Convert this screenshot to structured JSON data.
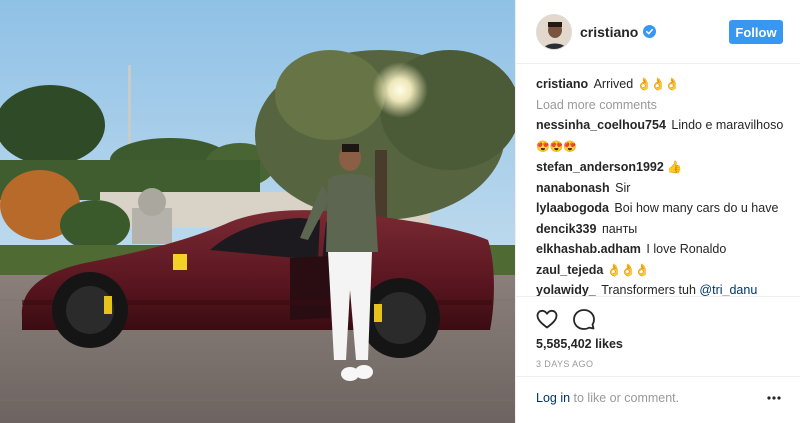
{
  "post": {
    "username": "cristiano",
    "follow_label": "Follow",
    "caption_user": "cristiano",
    "caption_text": "Arrived",
    "caption_emojis": "👌👌👌",
    "load_more": "Load more comments",
    "comments": [
      {
        "user": "nessinha_coelhou754",
        "text": "Lindo e maravilhoso",
        "emoji": "😍😍😍"
      },
      {
        "user": "stefan_anderson1992",
        "text": "",
        "emoji": "👍"
      },
      {
        "user": "nanabonash",
        "text": "Sir"
      },
      {
        "user": "lylaabogoda",
        "text": "Boi how many cars do u have"
      },
      {
        "user": "dencik339",
        "text": "панты"
      },
      {
        "user": "elkhashab.adham",
        "text": "I love Ronaldo"
      },
      {
        "user": "zaul_tejeda",
        "text": "",
        "emoji": "👌👌👌"
      },
      {
        "user": "yolawidy_",
        "text": "Transformers tuh",
        "mention": "@tri_danu"
      }
    ],
    "likes": "5,585,402 likes",
    "time_ago": "3 DAYS AGO",
    "login_link": "Log in",
    "login_suffix": " to like or comment."
  },
  "icons": {
    "verified": "verified-badge-icon",
    "like": "heart-icon",
    "comment": "comment-bubble-icon",
    "more": "more-options-icon"
  },
  "colors": {
    "follow_bg": "#3897f0",
    "verified": "#3897f0",
    "link": "#003569",
    "muted": "#999999"
  }
}
